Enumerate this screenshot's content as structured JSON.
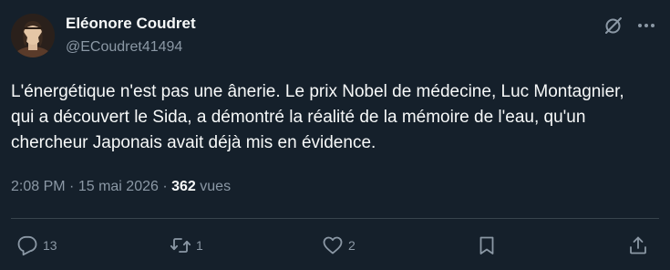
{
  "author": {
    "display_name": "Eléonore Coudret",
    "handle": "@ECoudret41494"
  },
  "tweet": {
    "text": "L'énergétique n'est pas une ânerie. Le prix Nobel de médecine, Luc Montagnier, qui a découvert le Sida, a démontré la réalité de la mémoire de l'eau, qu'un chercheur Japonais avait déjà mis en évidence.",
    "time": "2:08 PM",
    "separator": "·",
    "date": "15 mai 2026",
    "views_count": "362",
    "views_label": "vues"
  },
  "actions": {
    "reply": {
      "icon": "reply-icon",
      "count": "13"
    },
    "retweet": {
      "icon": "retweet-icon",
      "count": "1"
    },
    "like": {
      "icon": "heart-icon",
      "count": "2"
    },
    "bookmark": {
      "icon": "bookmark-icon"
    },
    "share": {
      "icon": "share-icon"
    }
  },
  "header_icons": [
    "grok-icon",
    "more-icon"
  ],
  "colors": {
    "background": "#15202b",
    "text_primary": "#f7f9f9",
    "text_secondary": "#8b98a5",
    "divider": "#38444d"
  }
}
